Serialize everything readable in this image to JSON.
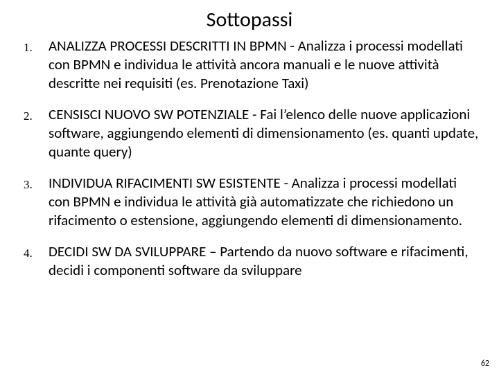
{
  "title": "Sottopassi",
  "items": [
    {
      "num": "1.",
      "text": "ANALIZZA PROCESSI DESCRITTI IN BPMN - Analizza i processi modellati con BPMN e individua le attività ancora manuali e le nuove attività descritte nei requisiti (es. Prenotazione Taxi)"
    },
    {
      "num": "2.",
      "text": "CENSISCI NUOVO SW POTENZIALE - Fai l’elenco delle nuove applicazioni software, aggiungendo elementi di dimensionamento (es. quanti update, quante query)"
    },
    {
      "num": "3.",
      "text": "INDIVIDUA RIFACIMENTI SW ESISTENTE - Analizza i processi modellati con BPMN e individua le attività già automatizzate che richiedono un rifacimento o estensione, aggiungendo elementi di dimensionamento."
    },
    {
      "num": "4.",
      "text": "DECIDI SW DA SVILUPPARE – Partendo da nuovo software e rifacimenti, decidi i componenti software da sviluppare"
    }
  ],
  "page_number": "62"
}
